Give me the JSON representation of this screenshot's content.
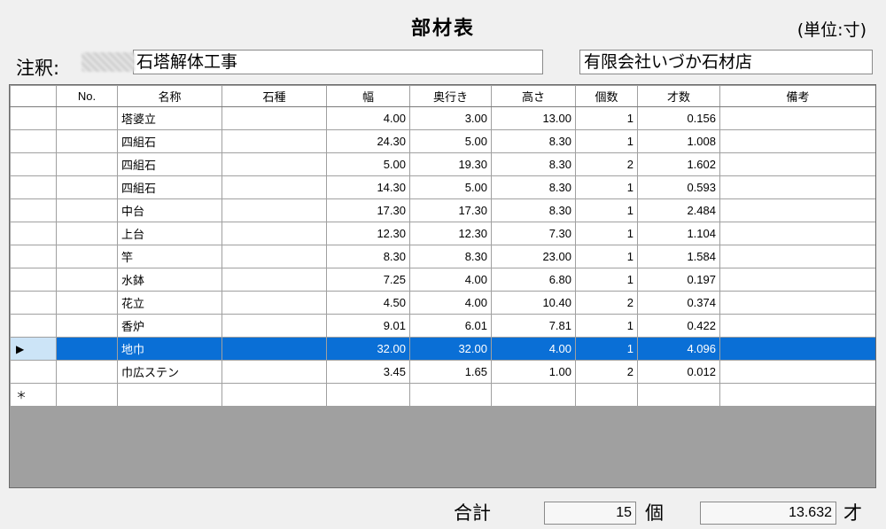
{
  "header": {
    "title": "部材表",
    "unit_note": "(単位:寸)"
  },
  "note": {
    "label": "注釈:",
    "project": "石塔解体工事",
    "company": "有限会社いづか石材店"
  },
  "grid": {
    "columns": [
      "No.",
      "名称",
      "石種",
      "幅",
      "奥行き",
      "高さ",
      "個数",
      "才数",
      "備考"
    ],
    "rows": [
      {
        "marker": "",
        "no": "",
        "name": "塔婆立",
        "stone": "",
        "width": "4.00",
        "depth": "3.00",
        "height": "13.00",
        "count": "1",
        "volume": "0.156",
        "remark": ""
      },
      {
        "marker": "",
        "no": "",
        "name": "四組石",
        "stone": "",
        "width": "24.30",
        "depth": "5.00",
        "height": "8.30",
        "count": "1",
        "volume": "1.008",
        "remark": ""
      },
      {
        "marker": "",
        "no": "",
        "name": "四組石",
        "stone": "",
        "width": "5.00",
        "depth": "19.30",
        "height": "8.30",
        "count": "2",
        "volume": "1.602",
        "remark": ""
      },
      {
        "marker": "",
        "no": "",
        "name": "四組石",
        "stone": "",
        "width": "14.30",
        "depth": "5.00",
        "height": "8.30",
        "count": "1",
        "volume": "0.593",
        "remark": ""
      },
      {
        "marker": "",
        "no": "",
        "name": "中台",
        "stone": "",
        "width": "17.30",
        "depth": "17.30",
        "height": "8.30",
        "count": "1",
        "volume": "2.484",
        "remark": ""
      },
      {
        "marker": "",
        "no": "",
        "name": "上台",
        "stone": "",
        "width": "12.30",
        "depth": "12.30",
        "height": "7.30",
        "count": "1",
        "volume": "1.104",
        "remark": ""
      },
      {
        "marker": "",
        "no": "",
        "name": "竿",
        "stone": "",
        "width": "8.30",
        "depth": "8.30",
        "height": "23.00",
        "count": "1",
        "volume": "1.584",
        "remark": ""
      },
      {
        "marker": "",
        "no": "",
        "name": "水鉢",
        "stone": "",
        "width": "7.25",
        "depth": "4.00",
        "height": "6.80",
        "count": "1",
        "volume": "0.197",
        "remark": ""
      },
      {
        "marker": "",
        "no": "",
        "name": "花立",
        "stone": "",
        "width": "4.50",
        "depth": "4.00",
        "height": "10.40",
        "count": "2",
        "volume": "0.374",
        "remark": ""
      },
      {
        "marker": "",
        "no": "",
        "name": "香炉",
        "stone": "",
        "width": "9.01",
        "depth": "6.01",
        "height": "7.81",
        "count": "1",
        "volume": "0.422",
        "remark": ""
      },
      {
        "marker": "▶",
        "no": "",
        "name": "地巾",
        "stone": "",
        "width": "32.00",
        "depth": "32.00",
        "height": "4.00",
        "count": "1",
        "volume": "4.096",
        "remark": "",
        "selected": true
      },
      {
        "marker": "",
        "no": "",
        "name": "巾広ステン",
        "stone": "",
        "width": "3.45",
        "depth": "1.65",
        "height": "1.00",
        "count": "2",
        "volume": "0.012",
        "remark": ""
      },
      {
        "marker": "＊",
        "no": "",
        "name": "",
        "stone": "",
        "width": "",
        "depth": "",
        "height": "",
        "count": "",
        "volume": "",
        "remark": ""
      }
    ]
  },
  "totals": {
    "label": "合計",
    "count": "15",
    "count_unit": "個",
    "volume": "13.632",
    "volume_unit": "才"
  },
  "colors": {
    "selection": "#0a6fd6",
    "row_header_selected": "#cce4f7",
    "empty_area": "#a0a0a0"
  }
}
